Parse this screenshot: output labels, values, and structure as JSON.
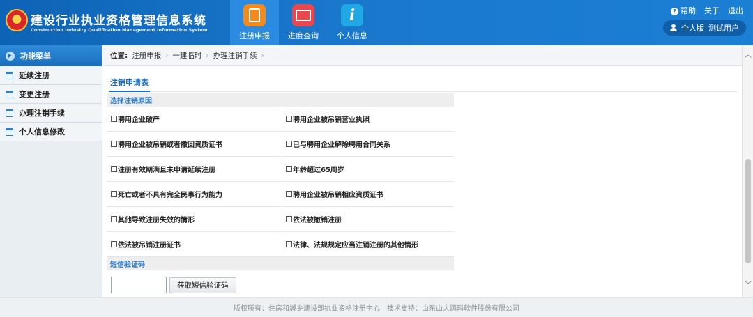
{
  "header": {
    "title_cn": "建设行业执业资格管理信息系统",
    "title_en": "Construction Industry Qualification Management Information System",
    "nav": [
      {
        "label": "注册申报",
        "icon": "report-icon",
        "active": true
      },
      {
        "label": "进度查询",
        "icon": "progress-icon",
        "active": false
      },
      {
        "label": "个人信息",
        "icon": "info-icon",
        "active": false
      }
    ],
    "links": {
      "help": "帮助",
      "about": "关于",
      "logout": "退出"
    },
    "user": {
      "edition": "个人版",
      "name": "测试用户"
    }
  },
  "colors": {
    "header_blue": "#1b7fd3",
    "accent_blue": "#1b6fc0"
  },
  "sidebar": {
    "title": "功能菜单",
    "items": [
      {
        "label": "延续注册"
      },
      {
        "label": "变更注册"
      },
      {
        "label": "办理注销手续"
      },
      {
        "label": "个人信息修改"
      }
    ]
  },
  "breadcrumb": {
    "prefix": "位置:",
    "items": [
      "注册申报",
      "一建临时",
      "办理注销手续"
    ]
  },
  "form": {
    "tab": "注销申请表",
    "reason_header": "选择注销原因",
    "reasons": [
      [
        "聘用企业破产",
        "聘用企业被吊销营业执照"
      ],
      [
        "聘用企业被吊销或者撤回资质证书",
        "已与聘用企业解除聘用合同关系"
      ],
      [
        "注册有效期满且未申请延续注册",
        "年龄超过65周岁"
      ],
      [
        "死亡或者不具有完全民事行为能力",
        "聘用企业被吊销相应资质证书"
      ],
      [
        "其他导致注册失效的情形",
        "依法被撤销注册"
      ],
      [
        "依法被吊销注册证书",
        "法律、法规规定应当注销注册的其他情形"
      ]
    ],
    "sms_header": "短信验证码",
    "sms_input_value": "",
    "sms_button": "获取短信验证码"
  },
  "footer": {
    "copyright": "版权所有：住房和城乡建设部执业资格注册中心",
    "support": "技术支持：山东山大鸥玛软件股份有限公司"
  }
}
